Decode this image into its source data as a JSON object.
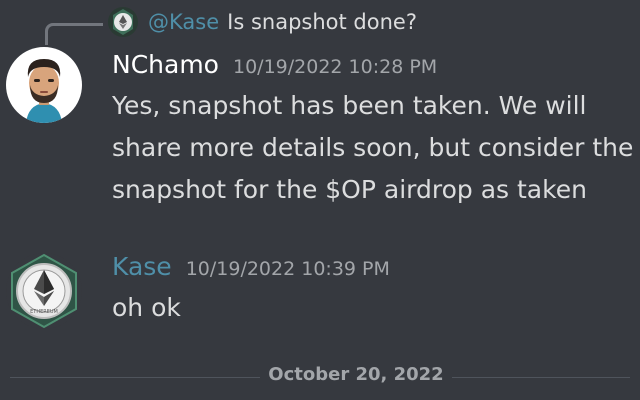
{
  "reply": {
    "mention": "@Kase",
    "text": "Is snapshot done?",
    "avatar_icon": "ethereum-icon"
  },
  "messages": [
    {
      "author": "NChamo",
      "author_color": "#ffffff",
      "timestamp": "10/19/2022 10:28 PM",
      "avatar_icon": "bearded-man-avatar",
      "lines": [
        "Yes, snapshot has been taken. We will",
        "share more details soon, but consider the",
        "snapshot for the $OP airdrop as taken"
      ]
    },
    {
      "author": "Kase",
      "author_color": "#4f8fa8",
      "timestamp": "10/19/2022 10:39 PM",
      "avatar_icon": "ethereum-icon",
      "lines": [
        "oh ok"
      ]
    }
  ],
  "divider": {
    "date": "October 20, 2022"
  },
  "colors": {
    "background": "#36393f",
    "text": "#dcddde",
    "muted": "#a3a6aa",
    "mention": "#4f8fa8"
  },
  "avatar_badge_text": "ETHEREUM"
}
